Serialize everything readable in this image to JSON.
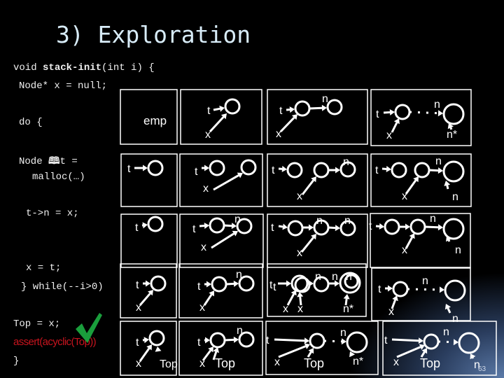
{
  "title": "3) Exploration",
  "code": {
    "line1_pre": "void ",
    "line1_bold": "stack-init",
    "line1_post": "(int i) {",
    "line2": "Node* x = null;",
    "line3": "do {",
    "line4_pre": "Node ",
    "line4_glyph": "🕮",
    "line4_post": "t =",
    "line5": "malloc(…)",
    "line6": "t->n = x;",
    "line7": "x = t;",
    "line8": "} while(--i>0)",
    "line9": "Top = x;",
    "assert": "assert(acyclic(Top))",
    "line11": "}"
  },
  "checkmark": {
    "icon": "check-icon",
    "color": "#1a9e3c"
  },
  "assert_color": "#c8141e",
  "panels": [
    {
      "labels": [
        "emp"
      ]
    },
    {
      "labels": [
        "t",
        "x"
      ]
    },
    {
      "labels": [
        "t",
        "n",
        "x"
      ]
    },
    {
      "labels": [
        "t",
        "n",
        "x",
        "n*"
      ]
    },
    {
      "labels": [
        "t"
      ]
    },
    {
      "labels": [
        "t",
        "x"
      ]
    },
    {
      "labels": [
        "t",
        "n",
        "x"
      ]
    },
    {
      "labels": [
        "t",
        "n",
        "x",
        "n"
      ]
    },
    {
      "labels": [
        "t"
      ]
    },
    {
      "labels": [
        "t",
        "n",
        "x"
      ]
    },
    {
      "labels": [
        "t",
        "n",
        "n",
        "x"
      ]
    },
    {
      "labels": [
        "t",
        "n",
        "x",
        "n"
      ]
    },
    {
      "labels": [
        "t",
        "x"
      ]
    },
    {
      "labels": [
        "t",
        "n",
        "x"
      ]
    },
    {
      "labels": [
        "t",
        "t",
        "n",
        "n",
        "n",
        "x",
        "x",
        "n*"
      ]
    },
    {
      "labels": [
        "t",
        "n",
        "x",
        "n"
      ]
    },
    {
      "labels": [
        "t",
        "x",
        "Top"
      ]
    },
    {
      "labels": [
        "t",
        "n",
        "x",
        "Top"
      ]
    },
    {
      "labels": [
        "t",
        "n",
        "x",
        "Top",
        "n*"
      ]
    },
    {
      "labels": [
        "t",
        "n",
        "x",
        "Top",
        "n"
      ]
    }
  ],
  "page_number": "63"
}
